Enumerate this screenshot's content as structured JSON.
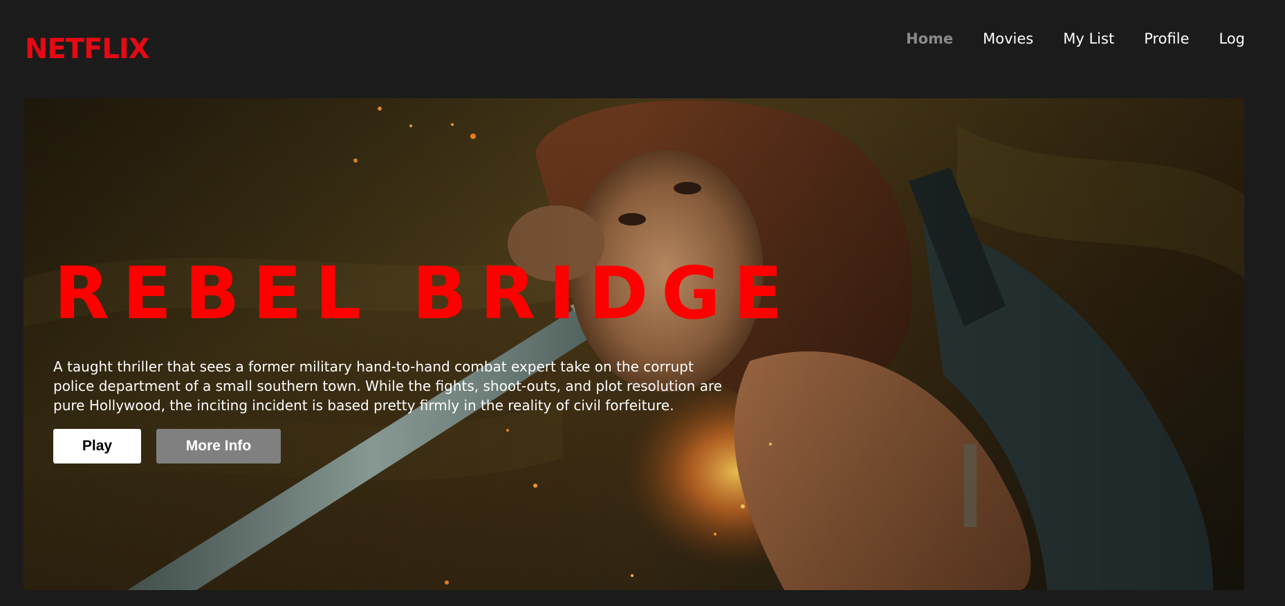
{
  "brand": {
    "logo_text": "NETFLIX",
    "color": "#e50914"
  },
  "nav": {
    "items": [
      {
        "label": "Home",
        "active": true
      },
      {
        "label": "Movies",
        "active": false
      },
      {
        "label": "My List",
        "active": false
      },
      {
        "label": "Profile",
        "active": false
      },
      {
        "label": "Log",
        "active": false
      }
    ]
  },
  "hero": {
    "title": "REBEL BRIDGE",
    "title_color": "#ff0000",
    "description": "A taught thriller that sees a former military hand-to-hand combat expert take on the corrupt police department of a small southern town. While the fights, shoot-outs, and plot resolution are pure Hollywood, the inciting incident is based pretty firmly in the reality of civil forfeiture.",
    "play_label": "Play",
    "more_info_label": "More Info"
  }
}
